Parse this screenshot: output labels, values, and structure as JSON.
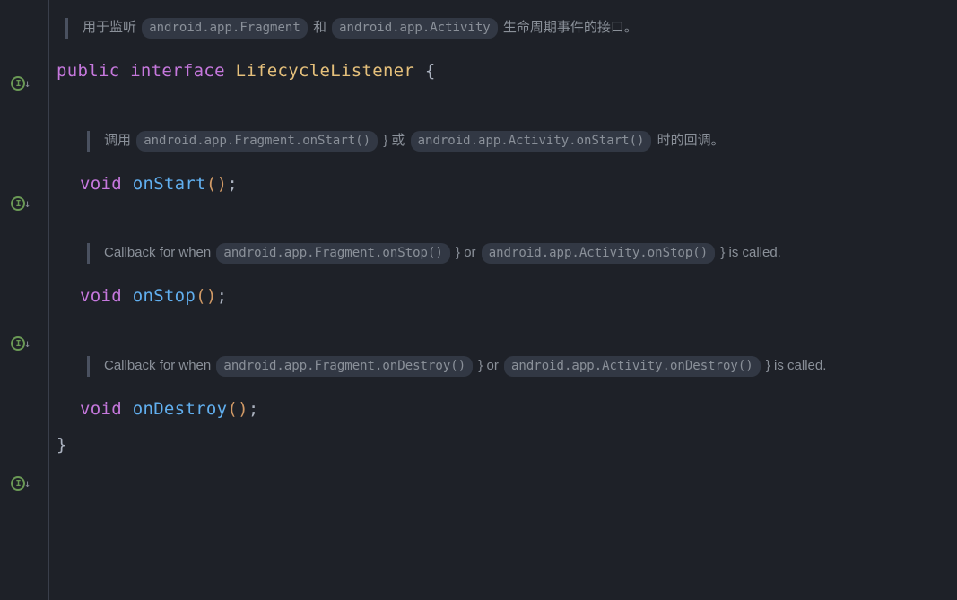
{
  "topDoc": {
    "prefix": "用于监听",
    "chip1": "android.app.Fragment",
    "mid": "和",
    "chip2": "android.app.Activity",
    "suffix": "生命周期事件的接口。"
  },
  "decl": {
    "kw1": "public",
    "kw2": "interface",
    "name": "LifecycleListener",
    "brace": "{"
  },
  "methods": [
    {
      "doc": {
        "prefix": "调用",
        "chip1": "android.app.Fragment.onStart()",
        "mid1": "} 或",
        "chip2": "android.app.Activity.onStart()",
        "suffix": "时的回调。"
      },
      "ret": "void",
      "name": "onStart",
      "parens": "()",
      "semi": ";"
    },
    {
      "doc": {
        "prefix": "Callback for when",
        "chip1": "android.app.Fragment.onStop()",
        "mid1": "} or",
        "chip2": "android.app.Activity.onStop()",
        "suffix": "} is called."
      },
      "ret": "void",
      "name": "onStop",
      "parens": "()",
      "semi": ";"
    },
    {
      "doc": {
        "prefix": "Callback for when",
        "chip1": "android.app.Fragment.onDestroy()",
        "mid1": "} or",
        "chip2": "android.app.Activity.onDestroy()",
        "suffix": "} is called."
      },
      "ret": "void",
      "name": "onDestroy",
      "parens": "()",
      "semi": ";"
    }
  ],
  "closeBrace": "}"
}
